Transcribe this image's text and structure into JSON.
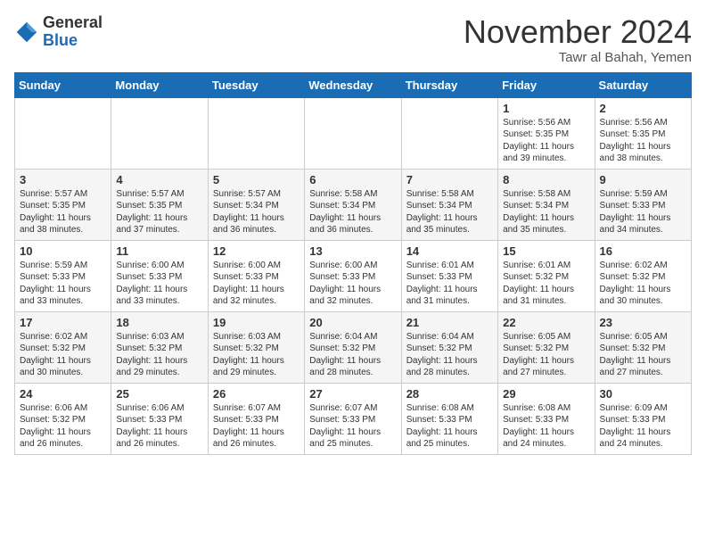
{
  "header": {
    "logo_general": "General",
    "logo_blue": "Blue",
    "month_title": "November 2024",
    "location": "Tawr al Bahah, Yemen"
  },
  "weekdays": [
    "Sunday",
    "Monday",
    "Tuesday",
    "Wednesday",
    "Thursday",
    "Friday",
    "Saturday"
  ],
  "weeks": [
    [
      {
        "day": "",
        "text": ""
      },
      {
        "day": "",
        "text": ""
      },
      {
        "day": "",
        "text": ""
      },
      {
        "day": "",
        "text": ""
      },
      {
        "day": "",
        "text": ""
      },
      {
        "day": "1",
        "text": "Sunrise: 5:56 AM\nSunset: 5:35 PM\nDaylight: 11 hours and 39 minutes."
      },
      {
        "day": "2",
        "text": "Sunrise: 5:56 AM\nSunset: 5:35 PM\nDaylight: 11 hours and 38 minutes."
      }
    ],
    [
      {
        "day": "3",
        "text": "Sunrise: 5:57 AM\nSunset: 5:35 PM\nDaylight: 11 hours and 38 minutes."
      },
      {
        "day": "4",
        "text": "Sunrise: 5:57 AM\nSunset: 5:35 PM\nDaylight: 11 hours and 37 minutes."
      },
      {
        "day": "5",
        "text": "Sunrise: 5:57 AM\nSunset: 5:34 PM\nDaylight: 11 hours and 36 minutes."
      },
      {
        "day": "6",
        "text": "Sunrise: 5:58 AM\nSunset: 5:34 PM\nDaylight: 11 hours and 36 minutes."
      },
      {
        "day": "7",
        "text": "Sunrise: 5:58 AM\nSunset: 5:34 PM\nDaylight: 11 hours and 35 minutes."
      },
      {
        "day": "8",
        "text": "Sunrise: 5:58 AM\nSunset: 5:34 PM\nDaylight: 11 hours and 35 minutes."
      },
      {
        "day": "9",
        "text": "Sunrise: 5:59 AM\nSunset: 5:33 PM\nDaylight: 11 hours and 34 minutes."
      }
    ],
    [
      {
        "day": "10",
        "text": "Sunrise: 5:59 AM\nSunset: 5:33 PM\nDaylight: 11 hours and 33 minutes."
      },
      {
        "day": "11",
        "text": "Sunrise: 6:00 AM\nSunset: 5:33 PM\nDaylight: 11 hours and 33 minutes."
      },
      {
        "day": "12",
        "text": "Sunrise: 6:00 AM\nSunset: 5:33 PM\nDaylight: 11 hours and 32 minutes."
      },
      {
        "day": "13",
        "text": "Sunrise: 6:00 AM\nSunset: 5:33 PM\nDaylight: 11 hours and 32 minutes."
      },
      {
        "day": "14",
        "text": "Sunrise: 6:01 AM\nSunset: 5:33 PM\nDaylight: 11 hours and 31 minutes."
      },
      {
        "day": "15",
        "text": "Sunrise: 6:01 AM\nSunset: 5:32 PM\nDaylight: 11 hours and 31 minutes."
      },
      {
        "day": "16",
        "text": "Sunrise: 6:02 AM\nSunset: 5:32 PM\nDaylight: 11 hours and 30 minutes."
      }
    ],
    [
      {
        "day": "17",
        "text": "Sunrise: 6:02 AM\nSunset: 5:32 PM\nDaylight: 11 hours and 30 minutes."
      },
      {
        "day": "18",
        "text": "Sunrise: 6:03 AM\nSunset: 5:32 PM\nDaylight: 11 hours and 29 minutes."
      },
      {
        "day": "19",
        "text": "Sunrise: 6:03 AM\nSunset: 5:32 PM\nDaylight: 11 hours and 29 minutes."
      },
      {
        "day": "20",
        "text": "Sunrise: 6:04 AM\nSunset: 5:32 PM\nDaylight: 11 hours and 28 minutes."
      },
      {
        "day": "21",
        "text": "Sunrise: 6:04 AM\nSunset: 5:32 PM\nDaylight: 11 hours and 28 minutes."
      },
      {
        "day": "22",
        "text": "Sunrise: 6:05 AM\nSunset: 5:32 PM\nDaylight: 11 hours and 27 minutes."
      },
      {
        "day": "23",
        "text": "Sunrise: 6:05 AM\nSunset: 5:32 PM\nDaylight: 11 hours and 27 minutes."
      }
    ],
    [
      {
        "day": "24",
        "text": "Sunrise: 6:06 AM\nSunset: 5:32 PM\nDaylight: 11 hours and 26 minutes."
      },
      {
        "day": "25",
        "text": "Sunrise: 6:06 AM\nSunset: 5:33 PM\nDaylight: 11 hours and 26 minutes."
      },
      {
        "day": "26",
        "text": "Sunrise: 6:07 AM\nSunset: 5:33 PM\nDaylight: 11 hours and 26 minutes."
      },
      {
        "day": "27",
        "text": "Sunrise: 6:07 AM\nSunset: 5:33 PM\nDaylight: 11 hours and 25 minutes."
      },
      {
        "day": "28",
        "text": "Sunrise: 6:08 AM\nSunset: 5:33 PM\nDaylight: 11 hours and 25 minutes."
      },
      {
        "day": "29",
        "text": "Sunrise: 6:08 AM\nSunset: 5:33 PM\nDaylight: 11 hours and 24 minutes."
      },
      {
        "day": "30",
        "text": "Sunrise: 6:09 AM\nSunset: 5:33 PM\nDaylight: 11 hours and 24 minutes."
      }
    ]
  ]
}
